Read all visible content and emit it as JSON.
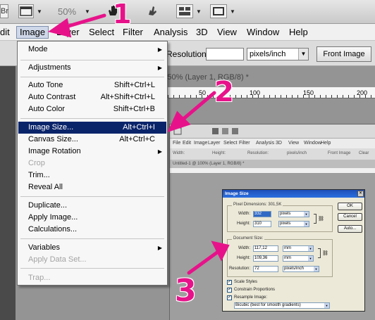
{
  "appbar": {
    "br_icon": "Br",
    "zoom": "50%",
    "icons": [
      "bridge-icon",
      "frame-icon",
      "hand-icon",
      "rotate-view-icon",
      "arrange-documents-icon",
      "screen-mode-icon"
    ]
  },
  "menubar": {
    "items": [
      "dit",
      "Image",
      "Layer",
      "Select",
      "Filter",
      "Analysis",
      "3D",
      "View",
      "Window",
      "Help"
    ]
  },
  "options_bar": {
    "resolution_label": "Resolution:",
    "resolution_value": "",
    "units_value": "pixels/inch",
    "front_image_label": "Front Image"
  },
  "document": {
    "tab_title": "1 @ 50% (Layer 1, RGB/8) *",
    "ruler_labels": [
      "50",
      "100",
      "150",
      "200"
    ]
  },
  "image_menu": {
    "items": [
      {
        "label": "Mode",
        "shortcut": "",
        "submenu": true,
        "disabled": false,
        "highlighted": false
      },
      {
        "label": "Adjustments",
        "shortcut": "",
        "submenu": true,
        "disabled": false,
        "highlighted": false
      },
      {
        "label": "Auto Tone",
        "shortcut": "Shift+Ctrl+L",
        "submenu": false,
        "disabled": false,
        "highlighted": false
      },
      {
        "label": "Auto Contrast",
        "shortcut": "Alt+Shift+Ctrl+L",
        "submenu": false,
        "disabled": false,
        "highlighted": false
      },
      {
        "label": "Auto Color",
        "shortcut": "Shift+Ctrl+B",
        "submenu": false,
        "disabled": false,
        "highlighted": false
      },
      {
        "label": "Image Size...",
        "shortcut": "Alt+Ctrl+I",
        "submenu": false,
        "disabled": false,
        "highlighted": true
      },
      {
        "label": "Canvas Size...",
        "shortcut": "Alt+Ctrl+C",
        "submenu": false,
        "disabled": false,
        "highlighted": false
      },
      {
        "label": "Image Rotation",
        "shortcut": "",
        "submenu": true,
        "disabled": false,
        "highlighted": false
      },
      {
        "label": "Crop",
        "shortcut": "",
        "submenu": false,
        "disabled": true,
        "highlighted": false
      },
      {
        "label": "Trim...",
        "shortcut": "",
        "submenu": false,
        "disabled": false,
        "highlighted": false
      },
      {
        "label": "Reveal All",
        "shortcut": "",
        "submenu": false,
        "disabled": false,
        "highlighted": false
      },
      {
        "label": "Duplicate...",
        "shortcut": "",
        "submenu": false,
        "disabled": false,
        "highlighted": false
      },
      {
        "label": "Apply Image...",
        "shortcut": "",
        "submenu": false,
        "disabled": false,
        "highlighted": false
      },
      {
        "label": "Calculations...",
        "shortcut": "",
        "submenu": false,
        "disabled": false,
        "highlighted": false
      },
      {
        "label": "Variables",
        "shortcut": "",
        "submenu": true,
        "disabled": false,
        "highlighted": false
      },
      {
        "label": "Apply Data Set...",
        "shortcut": "",
        "submenu": false,
        "disabled": true,
        "highlighted": false
      },
      {
        "label": "Trap...",
        "shortcut": "",
        "submenu": false,
        "disabled": true,
        "highlighted": false
      }
    ],
    "submenu_glyph": "▶"
  },
  "inner_screenshot": {
    "menu": [
      "File",
      "Edit",
      "Image",
      "Layer",
      "Select",
      "Filter",
      "Analysis",
      "3D",
      "View",
      "Window",
      "Help"
    ],
    "options": [
      "Width:",
      "Height:",
      "Resolution:",
      "pixels/inch",
      "Front Image",
      "Clear"
    ],
    "tab_title": "Untitled-1 @ 100% (Layer 1, RGB/8) *"
  },
  "image_size_dialog": {
    "title": "Image Size",
    "close_glyph": "×",
    "pixel_dimensions": {
      "title": "Pixel Dimensions:  301,5K",
      "width_label": "Width:",
      "width_value": "332",
      "width_unit": "pixels",
      "height_label": "Height:",
      "height_value": "310",
      "height_unit": "pixels"
    },
    "document_size": {
      "title": "Document Size:",
      "width_label": "Width:",
      "width_value": "117,12",
      "width_unit": "mm",
      "height_label": "Height:",
      "height_value": "109,36",
      "height_unit": "mm",
      "resolution_label": "Resolution:",
      "resolution_value": "72",
      "resolution_unit": "pixels/inch"
    },
    "buttons": {
      "ok": "OK",
      "cancel": "Cancel",
      "auto": "Auto..."
    },
    "checkboxes": [
      {
        "label": "Scale Styles",
        "checked": true
      },
      {
        "label": "Constrain Proportions",
        "checked": true
      },
      {
        "label": "Resample Image:",
        "checked": true
      }
    ],
    "check_glyph": "✓",
    "resample_method": "Bicubic (best for smooth gradients)"
  },
  "annotations": {
    "numbers": [
      "1",
      "2",
      "3"
    ],
    "color": "#e7128a"
  },
  "colors": {
    "menu_highlight": "#0a246a",
    "dialog_title": "#2b6fe0"
  }
}
